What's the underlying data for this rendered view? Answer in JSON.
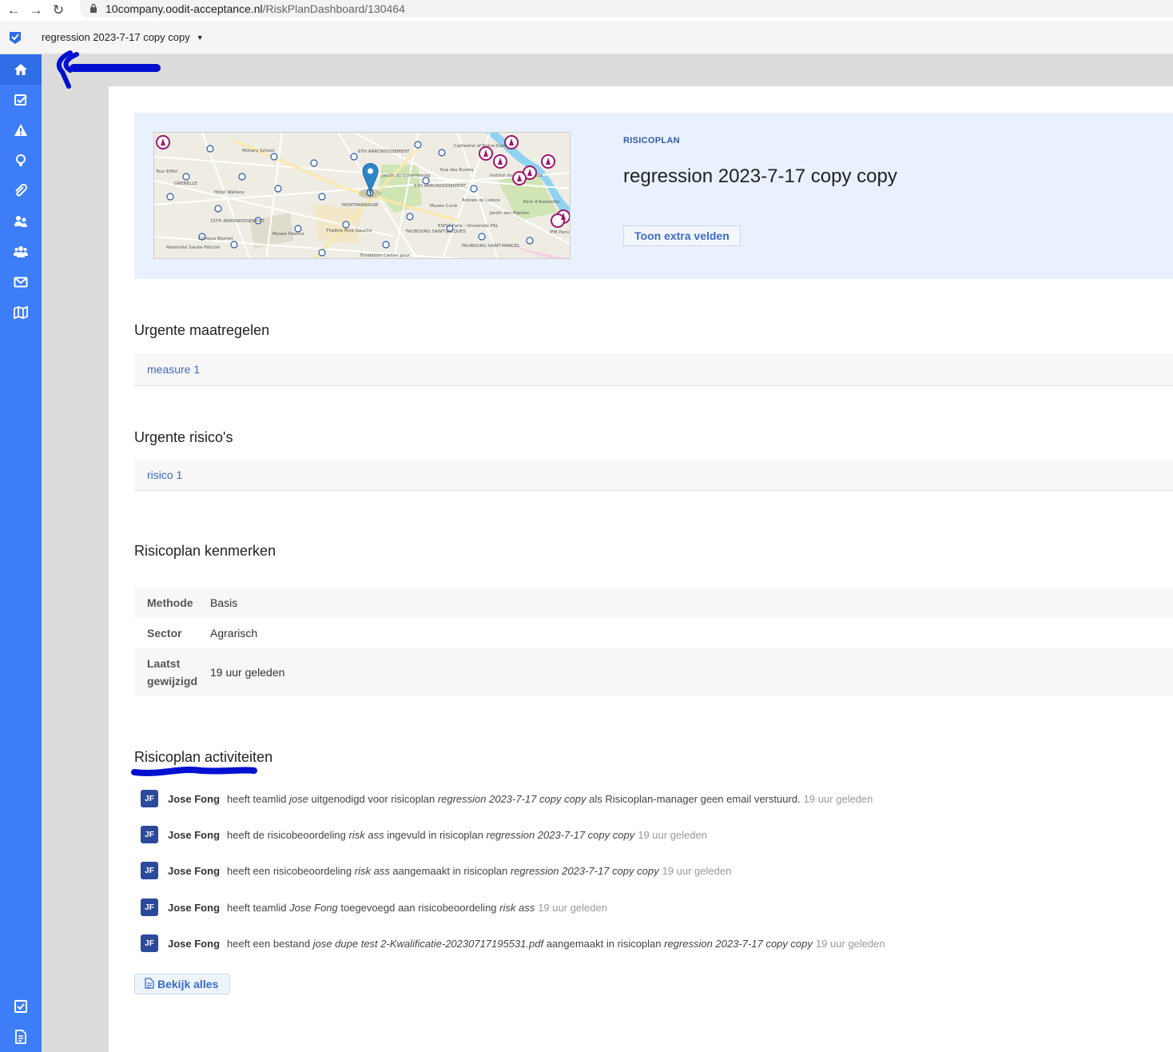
{
  "browser": {
    "url_host": "10company.oodit-acceptance.nl",
    "url_path": "/RiskPlanDashboard/130464"
  },
  "appbar": {
    "plan_name": "regression 2023-7-17 copy copy"
  },
  "sidebar": {
    "items": [
      {
        "icon": "home-icon"
      },
      {
        "icon": "checklist-icon"
      },
      {
        "icon": "warning-icon"
      },
      {
        "icon": "lightbulb-icon"
      },
      {
        "icon": "paperclip-icon"
      },
      {
        "icon": "user-group-icon"
      },
      {
        "icon": "users-icon"
      },
      {
        "icon": "envelope-icon"
      },
      {
        "icon": "map-icon"
      }
    ],
    "bottom_items": [
      {
        "icon": "checkbox-icon"
      },
      {
        "icon": "document-icon"
      }
    ]
  },
  "hero": {
    "eyebrow": "RISICOPLAN",
    "title": "regression 2023-7-17 copy copy",
    "extra_button": "Toon extra velden",
    "map_labels": [
      "Military School",
      "6TH ARRONDISSEMENT",
      "Jardin du Luxembourg",
      "5TH ARRONDISSEMENT",
      "GRENELLE",
      "Hôtel Wallace",
      "15TH ARRONDISSEMENT",
      "MONTPARNASSE",
      "Musée Curie",
      "Arènes de Lutèce",
      "Jardin des Plantes",
      "Musée Pasteur",
      "Théâtre Rive Gauche",
      "ESPCI Paris - Université PSL",
      "FAUBOURG SAINT-JACQUES",
      "FAUBOURG SAINT-MARCEL",
      "Fondation Cartier pour",
      "Clinique Blomet",
      "Rue des Écoles",
      "Institut du Monde Arabe",
      "IFM Paris",
      "Cathedral of Notre-Dame",
      "Pont d'Austerlitz",
      "Tour Eiffel",
      "Maternité Sainte-Félicité"
    ]
  },
  "urgent_measures": {
    "title": "Urgente maatregelen",
    "items": [
      "measure 1"
    ]
  },
  "urgent_risks": {
    "title": "Urgente risico's",
    "items": [
      "risico 1"
    ]
  },
  "properties": {
    "title": "Risicoplan kenmerken",
    "rows": [
      {
        "key": "Methode",
        "value": "Basis"
      },
      {
        "key": "Sector",
        "value": "Agrarisch"
      },
      {
        "key": "Laatst gewijzigd",
        "value": "19 uur geleden"
      }
    ]
  },
  "activities": {
    "title": "Risicoplan activiteiten",
    "items": [
      {
        "initials": "JF",
        "user": "Jose Fong",
        "parts": [
          "heeft teamlid ",
          "jose",
          " uitgenodigd voor risicoplan ",
          "regression 2023-7-17 copy copy",
          " als Risicoplan-manager geen email verstuurd."
        ],
        "time": "19 uur geleden"
      },
      {
        "initials": "JF",
        "user": "Jose Fong",
        "parts": [
          "heeft de risicobeoordeling ",
          "risk ass",
          " ingevuld in risicoplan ",
          "regression 2023-7-17 copy copy",
          ""
        ],
        "time": "19 uur geleden"
      },
      {
        "initials": "JF",
        "user": "Jose Fong",
        "parts": [
          "heeft een risicobeoordeling ",
          "risk ass",
          " aangemaakt in risicoplan ",
          "regression 2023-7-17 copy copy",
          ""
        ],
        "time": "19 uur geleden"
      },
      {
        "initials": "JF",
        "user": "Jose Fong",
        "parts": [
          "heeft teamlid ",
          "Jose Fong",
          " toegevoegd aan risicobeoordeling ",
          "risk ass",
          ""
        ],
        "time": "19 uur geleden"
      },
      {
        "initials": "JF",
        "user": "Jose Fong",
        "parts": [
          "heeft een bestand ",
          "jose dupe test 2-Kwalificatie-20230717195531.pdf",
          " aangemaakt in risicoplan ",
          "regression 2023-7-17 copy copy",
          ""
        ],
        "time": "19 uur geleden"
      }
    ],
    "view_all": "Bekijk alles"
  },
  "colors": {
    "sidebar": "#3d7ef8",
    "accent_link": "#3b6cc9",
    "hero_bg": "#e8f1fd",
    "avatar": "#2b4a9c",
    "annotation": "#0010d0"
  }
}
